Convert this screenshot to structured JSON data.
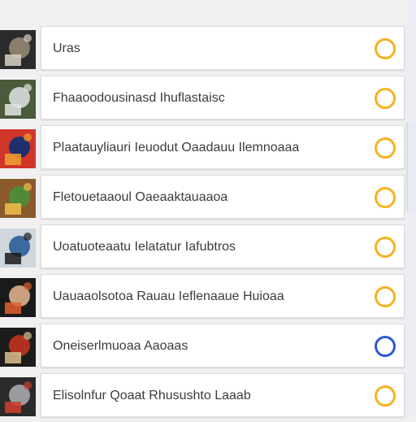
{
  "colors": {
    "ring_default": "#f5b21f",
    "ring_selected": "#2a5bd7"
  },
  "items": [
    {
      "label": "Uras",
      "status": "default",
      "thumb": [
        "#2b2b2b",
        "#8a7f6e",
        "#d8d2c4"
      ]
    },
    {
      "label": "Fhaaoodousinasd Ihuflastaisc",
      "status": "default",
      "thumb": [
        "#4a5a3a",
        "#c9cfc9",
        "#e2e6e2"
      ]
    },
    {
      "label": "Plaatauyliauri Ieuodut Oaadauu Ilemnoaaa",
      "status": "default",
      "thumb": [
        "#d0352a",
        "#1e2f6e",
        "#f0a030"
      ]
    },
    {
      "label": "Fletouetaaoul Oaeaaktauaaoa",
      "status": "default",
      "thumb": [
        "#8a5a2a",
        "#4f8a3a",
        "#f0c050"
      ]
    },
    {
      "label": "Uoatuoteaatu Ielatatur Iafubtros",
      "status": "default",
      "thumb": [
        "#cfd6dc",
        "#3a6aa0",
        "#1a1a1a"
      ]
    },
    {
      "label": "Uauaaolsotoa Rauau Ieflenaaue Huioaa",
      "status": "default",
      "thumb": [
        "#1a1a1a",
        "#c9a080",
        "#e06030"
      ]
    },
    {
      "label": "Oneiserlmuoaa Aaoaas",
      "status": "selected",
      "thumb": [
        "#1c1c1c",
        "#b03020",
        "#d8c090"
      ]
    },
    {
      "label": "Elisolnfur Qoaat Rhusushto Laaab",
      "status": "default",
      "thumb": [
        "#2a2a2a",
        "#9a9aa0",
        "#d04030"
      ]
    }
  ]
}
